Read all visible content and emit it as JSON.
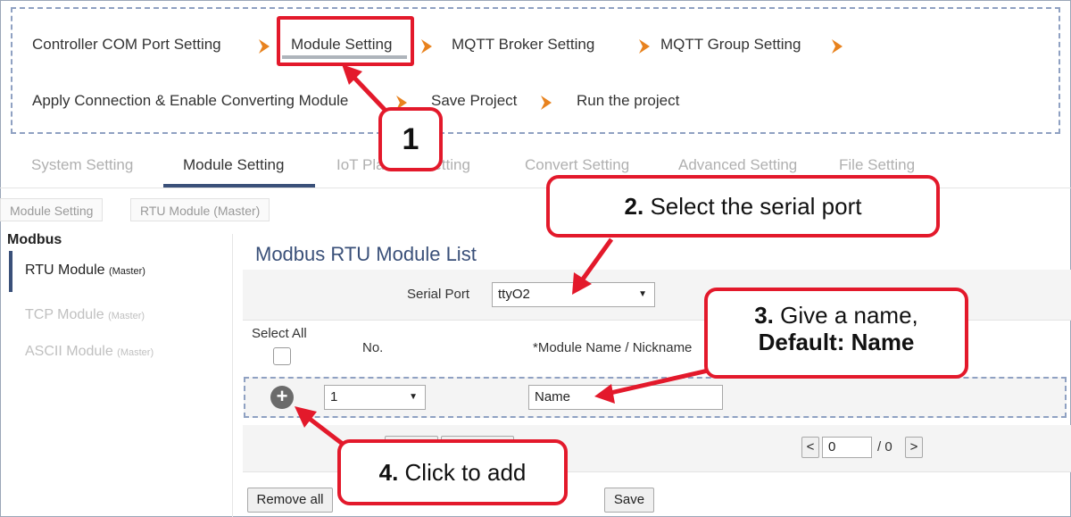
{
  "wizard": {
    "steps": [
      "Controller COM Port Setting",
      "Module Setting",
      "MQTT Broker Setting",
      "MQTT Group Setting",
      "Apply Connection & Enable Converting Module",
      "Save Project",
      "Run the project"
    ]
  },
  "tabs": [
    "System Setting",
    "Module Setting",
    "IoT Platform Setting",
    "Convert Setting",
    "Advanced Setting",
    "File Setting"
  ],
  "breadcrumb": [
    "Module Setting",
    "RTU Module (Master)"
  ],
  "sidebar": {
    "title": "Modbus",
    "items": [
      {
        "label": "RTU Module",
        "sub": "(Master)"
      },
      {
        "label": "TCP Module",
        "sub": "(Master)"
      },
      {
        "label": "ASCII Module",
        "sub": "(Master)"
      }
    ]
  },
  "main": {
    "title": "Modbus RTU Module List",
    "serial_port_label": "Serial Port",
    "serial_port_value": "ttyO2",
    "select_all_label": "Select All",
    "col_no": "No.",
    "col_name": "*Module Name / Nickname",
    "row_no_value": "1",
    "row_name_value": "Name",
    "pager_prev": "<",
    "pager_page": "0",
    "pager_total": "/ 0",
    "pager_next": ">",
    "remove_all_label": "Remove all",
    "save_label": "Save"
  },
  "callouts": {
    "c1": "1",
    "c2_num": "2.",
    "c2_text": " Select the serial port",
    "c3_num": "3.",
    "c3_text": " Give a name,",
    "c3_line2": "Default: Name",
    "c4_num": "4.",
    "c4_text": " Click to add"
  },
  "colors": {
    "accent": "#3a5079",
    "callout": "#e3192b",
    "chevron": "#e8821e"
  }
}
